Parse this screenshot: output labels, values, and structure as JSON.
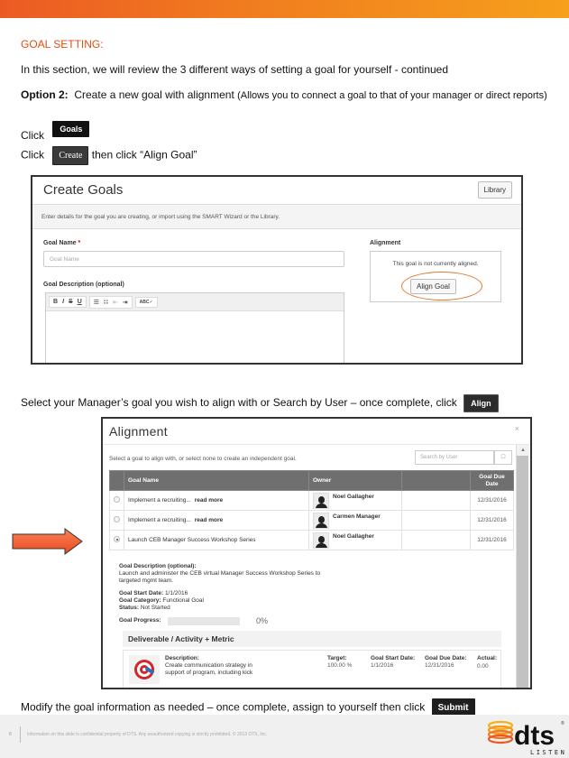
{
  "header": {
    "section_title": "GOAL SETTING:"
  },
  "intro": "In this section, we will review the 3 different ways of setting a goal for yourself - continued",
  "option": {
    "label": "Option 2:",
    "text": "Create a new goal with alignment",
    "note": "(Allows you to connect a goal to that of your manager or direct reports)"
  },
  "steps": {
    "click_word": "Click",
    "goals_button": "Goals",
    "create_button": "Create",
    "then_align": "then click “Align Goal”",
    "select_text": "Select your Manager’s goal you wish to align with or Search by User – once complete, click",
    "align_button": "Align",
    "modify_text": "Modify the goal information as needed – once complete, assign to yourself then click",
    "submit_button": "Submit"
  },
  "create_goals": {
    "title": "Create Goals",
    "library_button": "Library",
    "info": "Enter details for the goal you are creating, or import using the SMART Wizard or the Library.",
    "goal_name_label": "Goal Name",
    "required_mark": "*",
    "goal_name_placeholder": "Goal Name",
    "goal_desc_label": "Goal Description (optional)",
    "toolbar": [
      "B",
      "I",
      "S",
      "U",
      "☰",
      "∷",
      "⇤",
      "⇥",
      "ABC✓"
    ],
    "alignment_label": "Alignment",
    "alignment_status": "This goal is not currently aligned.",
    "align_goal_button": "Align Goal"
  },
  "alignment_modal": {
    "title": "Alignment",
    "close": "×",
    "hint": "Select a goal to align with, or select none to create an independent goal.",
    "search_placeholder": "Search by User",
    "columns": [
      "Goal Name",
      "Owner",
      "",
      "Goal Due Date"
    ],
    "rows": [
      {
        "goal": "Implement a recruiting...",
        "read_more": "read more",
        "owner": "Noel Gallagher",
        "due": "12/31/2016",
        "selected": false
      },
      {
        "goal": "Implement a recruiting...",
        "read_more": "read more",
        "owner": "Carmen Manager",
        "due": "12/31/2016",
        "selected": false
      },
      {
        "goal": "Launch CEB Manager Success Workshop Series",
        "read_more": "",
        "owner": "Noel Gallagher",
        "due": "12/31/2016",
        "selected": true
      }
    ],
    "detail": {
      "desc_label": "Goal Description (optional):",
      "desc_text_1": "Launch and administer the CEB virtual Manager Success Workshop Series to",
      "desc_text_2": "targeted mgmt team.",
      "start_label": "Goal Start Date:",
      "start_value": "1/1/2016",
      "category_label": "Goal Category:",
      "category_value": "Functional Goal",
      "status_label": "Status:",
      "status_value": "Not Started",
      "progress_label": "Goal Progress:",
      "progress_value": "0%",
      "progress_fraction": 0
    },
    "deliverable": {
      "heading": "Deliverable / Activity + Metric",
      "desc_label": "Description:",
      "desc_1": "Create communication strategy in",
      "desc_2": "support of program, including kick",
      "target_label": "Target:",
      "target_value": "100.00 %",
      "start_label": "Goal Start Date:",
      "start_value": "1/1/2016",
      "due_label": "Goal Due Date:",
      "due_value": "12/31/2016",
      "actual_label": "Actual:",
      "actual_value": "0.00"
    }
  },
  "footer": {
    "page_number": "8",
    "confidential": "Information on this slide is confidential property of DTS. Any unauthorized copying is strictly prohibited. © 2013 DTS, Inc.",
    "logo_text": "dts",
    "logo_tagline": "LISTEN"
  },
  "colors": {
    "accent_orange": "#e04e12",
    "bar_start": "#ec5a24",
    "bar_end": "#f6a01c",
    "arrow": "#f26a3c",
    "table_header": "#6f6f6f"
  }
}
